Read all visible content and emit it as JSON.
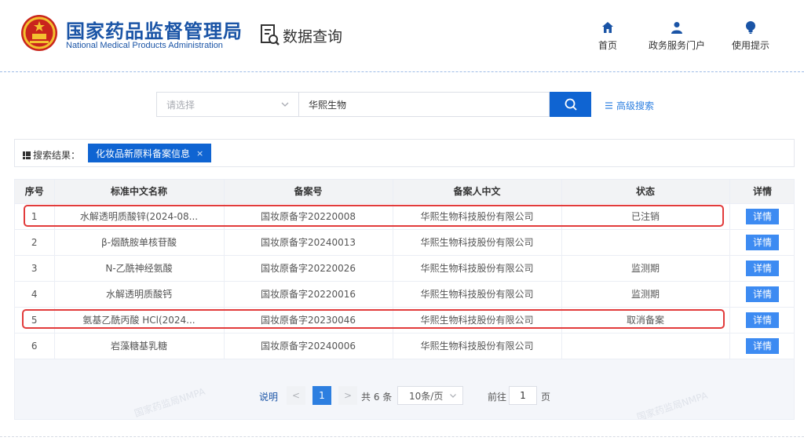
{
  "header": {
    "site_title": "国家药品监督管理局",
    "site_subtitle": "National Medical Products Administration",
    "section_title": "数据查询",
    "nav": [
      {
        "label": "首页",
        "icon": "home-icon"
      },
      {
        "label": "政务服务门户",
        "icon": "user-icon"
      },
      {
        "label": "使用提示",
        "icon": "bulb-icon"
      }
    ]
  },
  "search": {
    "select_placeholder": "请选择",
    "query": "华熙生物",
    "advanced_label": "高级搜索"
  },
  "results": {
    "label": "搜索结果：",
    "tag": "化妆品新原料备案信息",
    "tag_close": "×"
  },
  "table": {
    "headers": [
      "序号",
      "标准中文名称",
      "备案号",
      "备案人中文",
      "状态",
      "详情"
    ],
    "detail_label": "详情",
    "rows": [
      {
        "no": "1",
        "name": "水解透明质酸锌(2024-08...",
        "record": "国妆原备字20220008",
        "filer": "华熙生物科技股份有限公司",
        "status": "已注销"
      },
      {
        "no": "2",
        "name": "β-烟酰胺单核苷酸",
        "record": "国妆原备字20240013",
        "filer": "华熙生物科技股份有限公司",
        "status": ""
      },
      {
        "no": "3",
        "name": "N-乙酰神经氨酸",
        "record": "国妆原备字20220026",
        "filer": "华熙生物科技股份有限公司",
        "status": "监测期"
      },
      {
        "no": "4",
        "name": "水解透明质酸钙",
        "record": "国妆原备字20220016",
        "filer": "华熙生物科技股份有限公司",
        "status": "监测期"
      },
      {
        "no": "5",
        "name": "氨基乙酰丙酸 HCl(2024...",
        "record": "国妆原备字20230046",
        "filer": "华熙生物科技股份有限公司",
        "status": "取消备案"
      },
      {
        "no": "6",
        "name": "岩藻糖基乳糖",
        "record": "国妆原备字20240006",
        "filer": "华熙生物科技股份有限公司",
        "status": ""
      }
    ]
  },
  "pagination": {
    "explain": "说明",
    "prev": "<",
    "current": "1",
    "next": ">",
    "total": "共 6 条",
    "page_size": "10条/页",
    "goto_label": "前往",
    "goto_value": "1",
    "page_suffix": "页"
  },
  "watermark": "国家药监局NMPA",
  "colors": {
    "brand_blue": "#1a54a6",
    "primary": "#0f64d2",
    "button": "#3d8bf2",
    "highlight_red": "#e23b3b"
  }
}
